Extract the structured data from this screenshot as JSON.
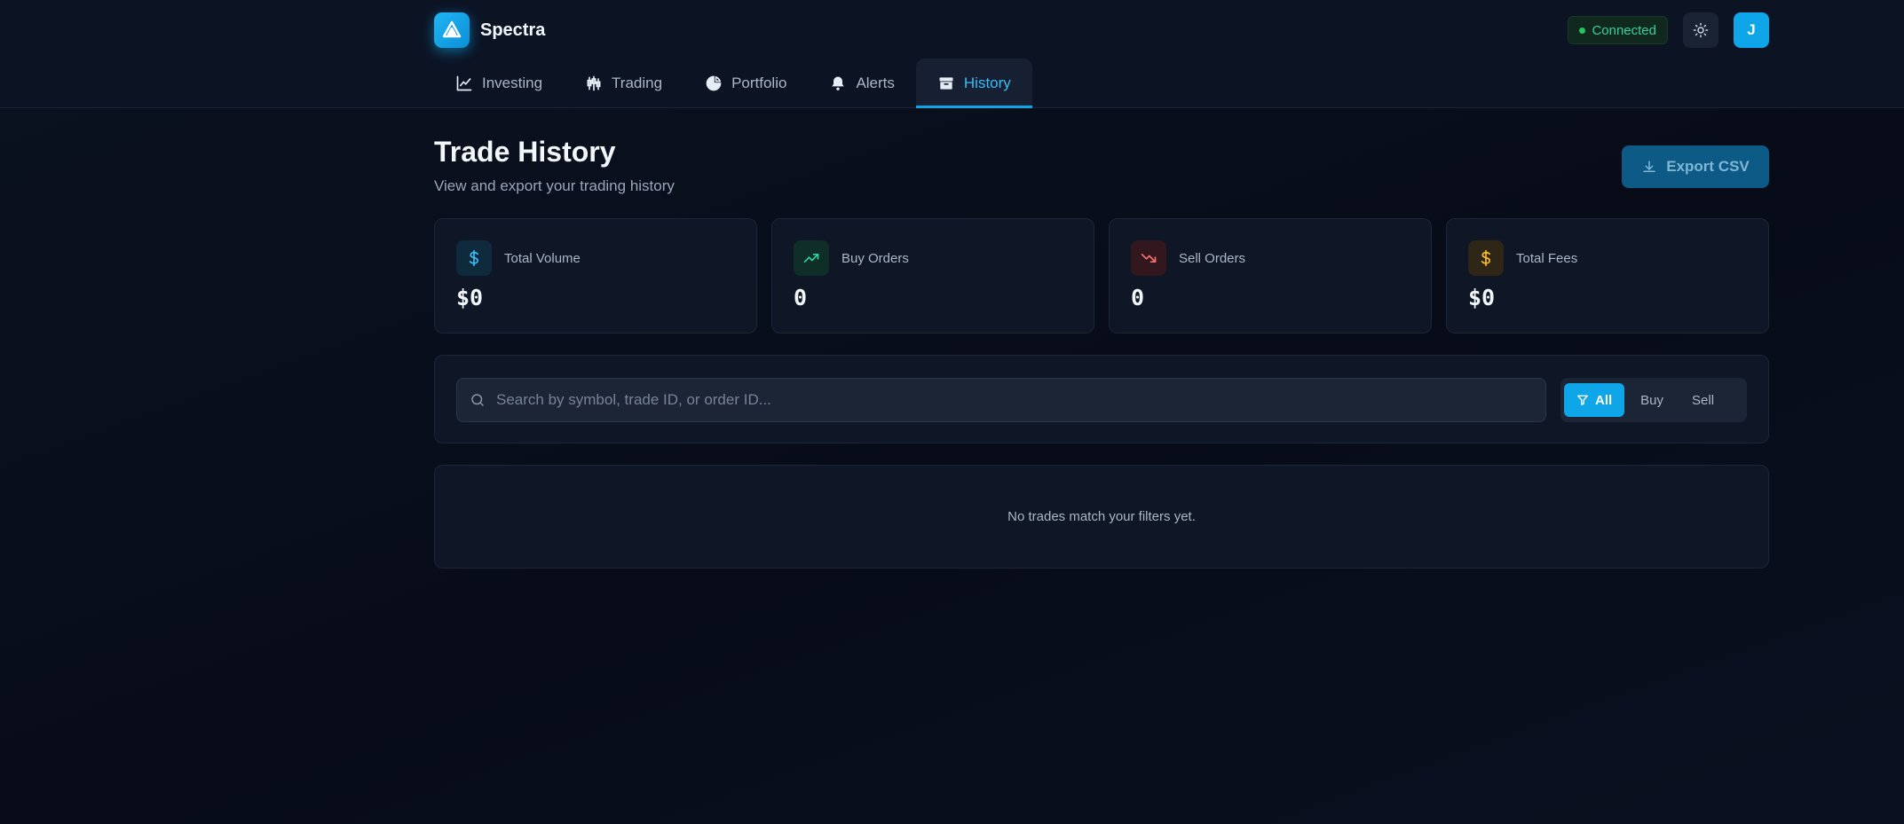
{
  "app": {
    "name": "Spectra"
  },
  "status": {
    "label": "Connected"
  },
  "user": {
    "initial": "J"
  },
  "nav": {
    "tabs": [
      {
        "label": "Investing",
        "icon": "line-chart-icon"
      },
      {
        "label": "Trading",
        "icon": "candlestick-icon"
      },
      {
        "label": "Portfolio",
        "icon": "pie-chart-icon"
      },
      {
        "label": "Alerts",
        "icon": "bell-icon"
      },
      {
        "label": "History",
        "icon": "archive-icon",
        "active": true
      }
    ]
  },
  "page": {
    "title": "Trade History",
    "subtitle": "View and export your trading history",
    "export_label": "Export CSV"
  },
  "stats": [
    {
      "label": "Total Volume",
      "value": "$0",
      "icon": "dollar-icon",
      "color": "#38bdf8"
    },
    {
      "label": "Buy Orders",
      "value": "0",
      "icon": "trending-up-icon",
      "color": "#34d399"
    },
    {
      "label": "Sell Orders",
      "value": "0",
      "icon": "trending-down-icon",
      "color": "#f87171"
    },
    {
      "label": "Total Fees",
      "value": "$0",
      "icon": "dollar-icon",
      "color": "#fbbf24"
    }
  ],
  "filters": {
    "search_placeholder": "Search by symbol, trade ID, or order ID...",
    "search_value": "",
    "options": [
      "All",
      "Buy",
      "Sell"
    ],
    "selected": "All"
  },
  "empty_message": "No trades match your filters yet.",
  "colors": {
    "accent": "#0ea5e9",
    "background": "#0b1220",
    "surface": "#0f1726"
  }
}
